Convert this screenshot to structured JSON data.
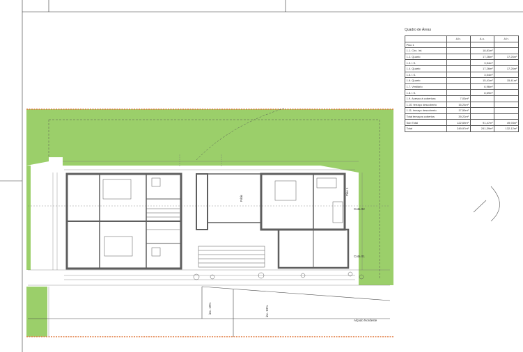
{
  "table": {
    "title": "Quadro de Áreas",
    "columns": [
      "",
      "A.b.",
      "A.u.",
      "A.h."
    ],
    "rows": [
      [
        "Piso 1",
        "",
        "",
        ""
      ],
      [
        "1.1. Circ. Int.",
        "",
        "18,81m²",
        ""
      ],
      [
        "1.2. Quarto",
        "",
        "17,26m²",
        "17,26m²"
      ],
      [
        "1.3. I.S.",
        "",
        "3,54m²",
        ""
      ],
      [
        "1.4. Quarto",
        "",
        "17,26m²",
        "17,26m²"
      ],
      [
        "1.5. I.S.",
        "",
        "3,54m²",
        ""
      ],
      [
        "1.6. Quarto",
        "",
        "15,41m²",
        "15,41m²"
      ],
      [
        "1.7. Vestiário",
        "",
        "6,96m²",
        ""
      ],
      [
        "1.8. I.S.",
        "",
        "8,69m²",
        ""
      ],
      [
        "1.9. Acesso à cobertura",
        "7,03m²",
        "",
        ""
      ],
      [
        "1.10. terraço descoberto",
        "16,24m²",
        "",
        ""
      ],
      [
        "1.11. terraço descoberto",
        "17,50m²",
        "",
        ""
      ],
      [
        "Total terraços cobertos",
        "39,22m²",
        "",
        ""
      ],
      [
        "Sub Total",
        "122,69m²",
        "91,47m²",
        "49,93m²"
      ],
      [
        "Total",
        "249,97m²",
        "241,39m²",
        "132,12m²"
      ]
    ]
  },
  "plan": {
    "labels": {
      "piso": "Piso 1",
      "cota_02": "Cota 02",
      "cota_01": "Cota 01",
      "alcado": "Alçado Nordeste",
      "patio": "Pátio",
      "ramp_1": "inc. 19%",
      "ramp_2": "inc. 19%"
    }
  },
  "colors": {
    "green": "#9bcf6a",
    "boundary": "#e0763a",
    "wall": "#6b6b6b",
    "line": "#444444"
  }
}
